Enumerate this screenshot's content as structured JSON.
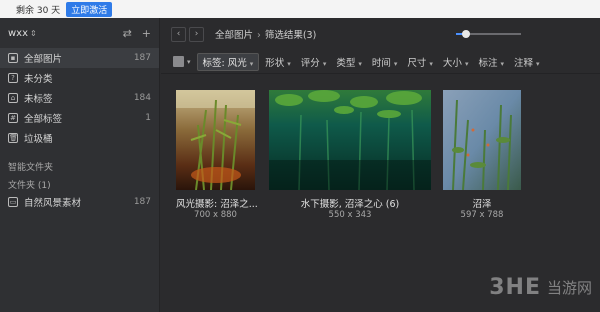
{
  "topbar": {
    "trial": "剩余 30 天",
    "activate": "立即激活"
  },
  "library": {
    "name": "wxx"
  },
  "sidebar": {
    "items": [
      {
        "label": "全部图片",
        "count": "187"
      },
      {
        "label": "未分类",
        "count": ""
      },
      {
        "label": "未标签",
        "count": "184"
      },
      {
        "label": "全部标签",
        "count": "1"
      },
      {
        "label": "垃圾桶",
        "count": ""
      }
    ],
    "smart_section": "智能文件夹",
    "folder_section": "文件夹 (1)",
    "folders": [
      {
        "label": "自然风景素材",
        "count": "187"
      }
    ]
  },
  "breadcrumb": {
    "root": "全部图片",
    "current": "筛选结果(3)"
  },
  "zoom": {
    "level": 0.15
  },
  "filters": {
    "tag_chip": "标签: 风光",
    "items": [
      "形状",
      "评分",
      "类型",
      "时间",
      "尺寸",
      "大小",
      "标注",
      "注释"
    ]
  },
  "images": [
    {
      "name": "风光摄影: 沼泽之...",
      "dims": "700 x 880"
    },
    {
      "name": "水下摄影, 沼泽之心 (6)",
      "dims": "550 x 343"
    },
    {
      "name": "沼泽",
      "dims": "597 x 788"
    }
  ],
  "watermark": {
    "logo": "3HE",
    "text": "当游网"
  },
  "colors": {
    "accent": "#2f7be8",
    "slider": "#4a90ff",
    "sidebar_bg": "#2f3033",
    "main_bg": "#2b2b2d"
  }
}
